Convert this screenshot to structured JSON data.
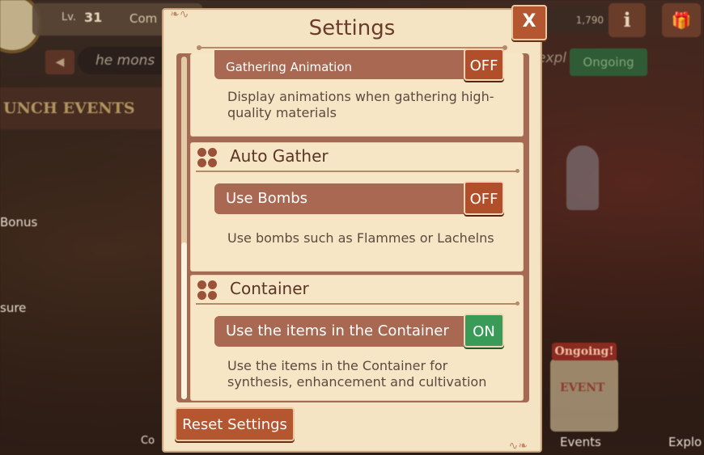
{
  "background": {
    "level_label": "Lv.",
    "level_value": "31",
    "top_text": "Com",
    "gold": "1,790",
    "info_icon": "i",
    "gift_icon": "gift-icon",
    "ticker": "he mons",
    "expl_text": "expl",
    "ongoing_bar": "Ongoing",
    "launch_banner": "UNCH EVENTS",
    "bonus_label": "Bonus",
    "sure_label": "sure",
    "ongoing_badge": "Ongoing!",
    "event_card": "EVENT",
    "events_label": "Events",
    "explore_label": "Explo",
    "com_label": "Co"
  },
  "settings": {
    "title": "Settings",
    "close_label": "X",
    "sections": [
      {
        "option": "Gathering Animation",
        "state": "OFF",
        "description": "Display animations when gathering high-quality materials"
      },
      {
        "heading": "Auto Gather",
        "option": "Use Bombs",
        "state": "OFF",
        "description": "Use bombs such as Flammes or Lachelns"
      },
      {
        "heading": "Container",
        "option": "Use the items in the Container",
        "state": "ON",
        "description": "Use the items in the Container for synthesis, enhancement and cultivation"
      }
    ],
    "reset_label": "Reset Settings"
  },
  "colors": {
    "panel": "#f4e4c4",
    "toggle_off": "#b24f2b",
    "toggle_on": "#3a9a58",
    "row": "#a86851"
  }
}
